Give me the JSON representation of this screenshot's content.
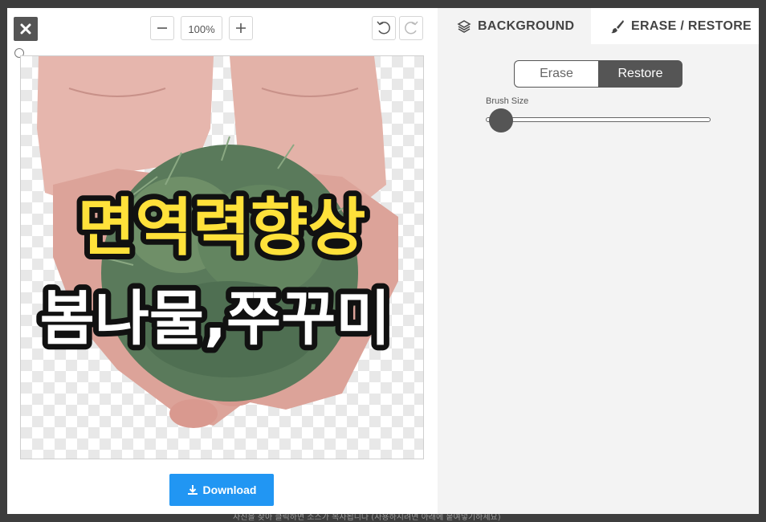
{
  "toolbar": {
    "close_icon": "close-icon",
    "zoom_out_icon": "minus-icon",
    "zoom_value": "100%",
    "zoom_in_icon": "plus-icon",
    "undo_icon": "undo-icon",
    "redo_icon": "redo-icon"
  },
  "canvas": {
    "line1": "면역력향상",
    "line2": "봄나물,쭈꾸미",
    "line1_color": "#ffe13a",
    "line2_color": "#ffffff",
    "outline_color": "#111111"
  },
  "download": {
    "label": "Download",
    "icon": "download-icon",
    "color": "#2196f3"
  },
  "tabs": [
    {
      "label": "BACKGROUND",
      "icon": "layers-icon",
      "active": false
    },
    {
      "label": "ERASE / RESTORE",
      "icon": "brush-icon",
      "active": true
    }
  ],
  "mode": {
    "erase_label": "Erase",
    "restore_label": "Restore",
    "selected": "Restore"
  },
  "brush": {
    "label": "Brush Size",
    "value_fraction": 0.07
  },
  "footer_partial": "사진을 찾아 클릭하면 소스가 복사됩니다 (사용하시려면 아래에 붙여넣기하세요)"
}
